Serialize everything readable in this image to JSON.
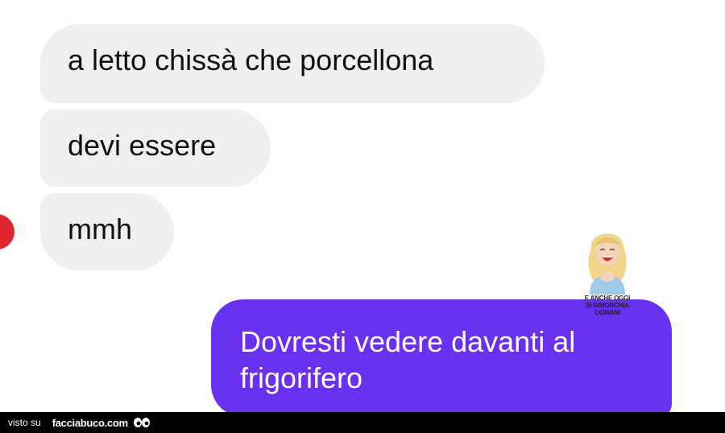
{
  "chat": {
    "messages": [
      {
        "direction": "incoming",
        "text": "a letto chissà che porcellona"
      },
      {
        "direction": "incoming",
        "text": "devi essere"
      },
      {
        "direction": "incoming",
        "text": "mmh"
      },
      {
        "direction": "outgoing",
        "text": "Dovresti vedere davanti al frigorifero"
      }
    ],
    "colors": {
      "incoming_bg": "#efefef",
      "outgoing_bg": "#6a30f0",
      "avatar": "#e0262c"
    }
  },
  "sticker": {
    "line1": "E ANCHE OGGI",
    "line2": "SI RIMORCHIA DOMANI",
    "icon": "laughing-woman-sticker"
  },
  "footer": {
    "prefix": "visto su",
    "brand": "facciabuco.com",
    "icon": "eyes-icon"
  }
}
